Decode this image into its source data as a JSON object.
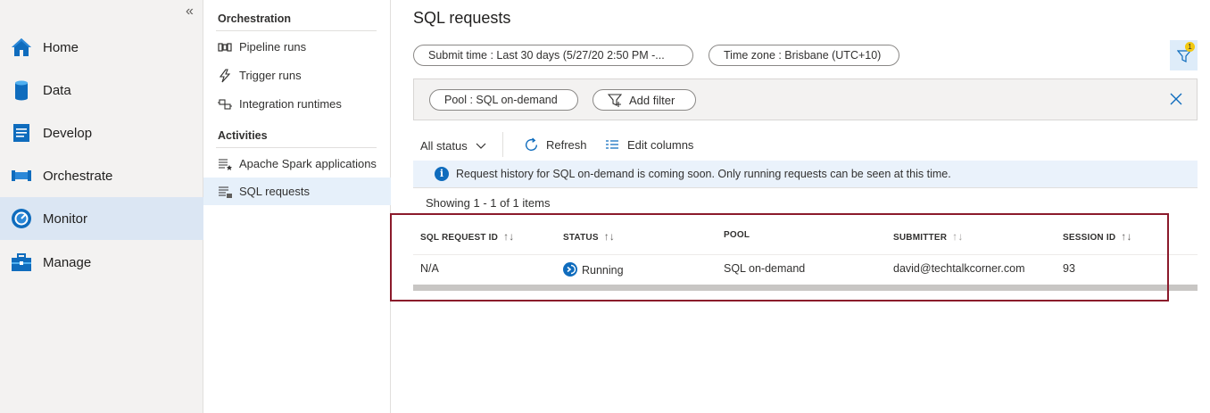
{
  "nav": {
    "collapse_glyph": "«",
    "items": [
      {
        "label": "Home",
        "icon": "home-icon"
      },
      {
        "label": "Data",
        "icon": "database-icon"
      },
      {
        "label": "Develop",
        "icon": "document-icon"
      },
      {
        "label": "Orchestrate",
        "icon": "pipeline-icon"
      },
      {
        "label": "Monitor",
        "icon": "gauge-icon",
        "active": true
      },
      {
        "label": "Manage",
        "icon": "toolbox-icon"
      }
    ]
  },
  "panel": {
    "orchestration_heading": "Orchestration",
    "orchestration_items": [
      {
        "label": "Pipeline runs",
        "icon": "pipeline-runs-icon"
      },
      {
        "label": "Trigger runs",
        "icon": "lightning-icon"
      },
      {
        "label": "Integration runtimes",
        "icon": "integration-runtime-icon"
      }
    ],
    "activities_heading": "Activities",
    "activities_items": [
      {
        "label": "Apache Spark applications",
        "icon": "spark-list-icon"
      },
      {
        "label": "SQL requests",
        "icon": "sql-list-icon",
        "active": true
      }
    ]
  },
  "main": {
    "title": "SQL requests",
    "submit_time_filter": "Submit time : Last 30 days (5/27/20 2:50 PM -...",
    "timezone_filter": "Time zone : Brisbane (UTC+10)",
    "filter_badge_count": "1",
    "pool_filter": "Pool : SQL on-demand",
    "add_filter_label": "Add filter",
    "status_dropdown": "All status",
    "refresh_label": "Refresh",
    "edit_columns_label": "Edit columns",
    "info_text": "Request history for SQL on-demand is coming soon. Only running requests can be seen at this time.",
    "showing_text": "Showing 1 - 1 of 1 items"
  },
  "table": {
    "columns": [
      "SQL REQUEST ID",
      "STATUS",
      "POOL",
      "SUBMITTER",
      "SESSION ID"
    ],
    "sort_glyph": "↑↓",
    "rows": [
      {
        "sql_request_id": "N/A",
        "status": "Running",
        "pool": "SQL on-demand",
        "submitter": "david@techtalkcorner.com",
        "session_id": "93"
      }
    ]
  },
  "colors": {
    "accent": "#0f6cbd",
    "highlight_border": "#8b1a2b",
    "nav_active": "#dbe6f3"
  }
}
